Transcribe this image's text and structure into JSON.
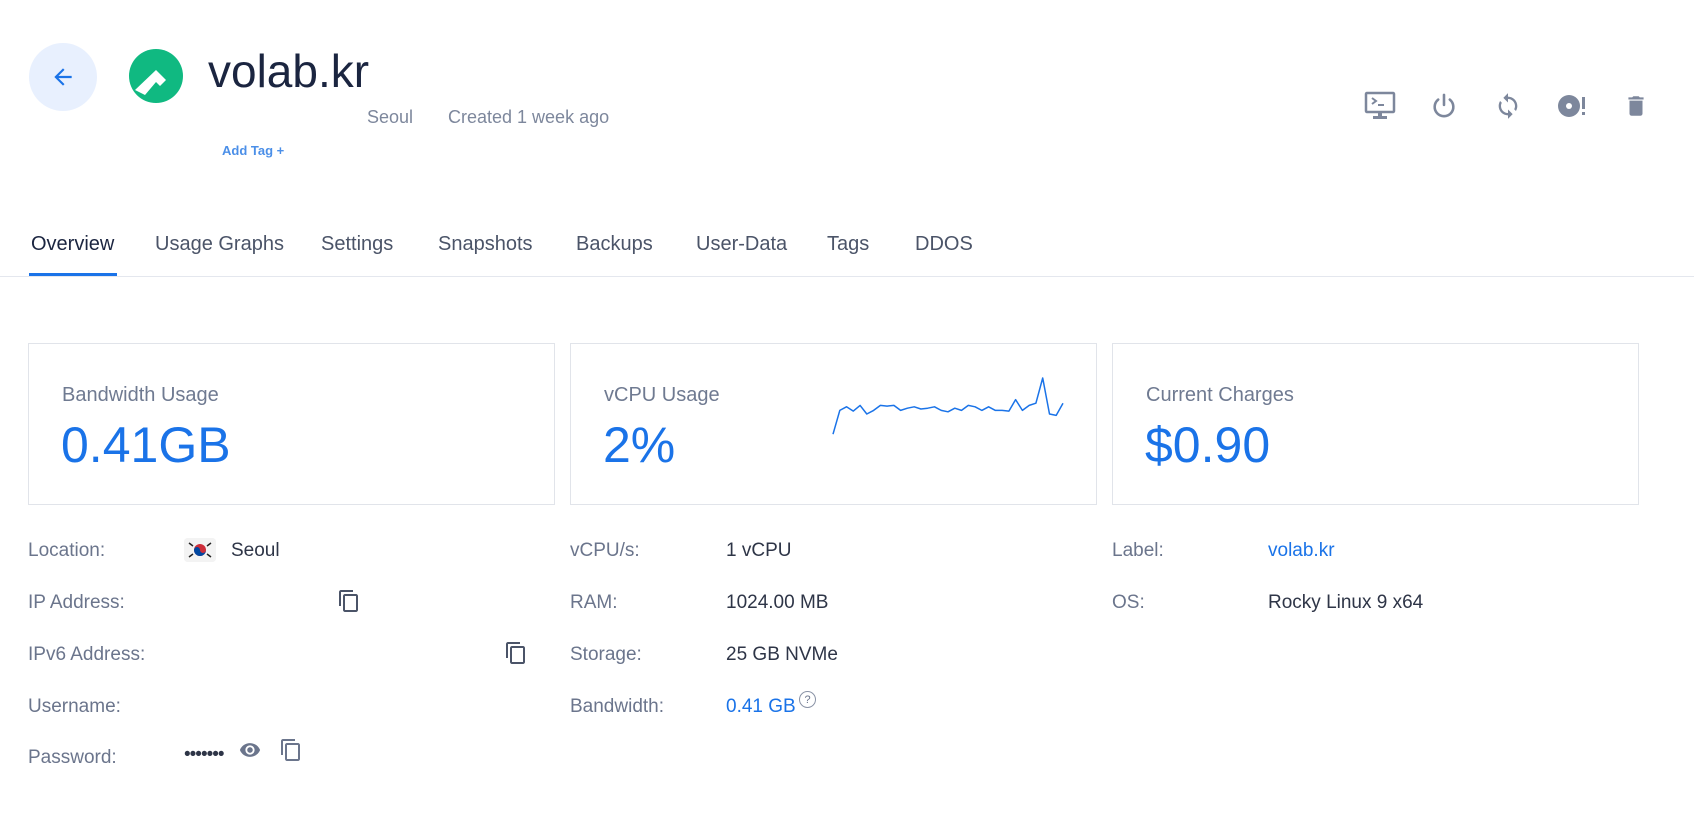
{
  "header": {
    "title": "volab.kr",
    "location": "Seoul",
    "created": "Created 1 week ago",
    "add_tag": "Add Tag +",
    "back_icon": "arrow-left-icon",
    "os_logo": "rocky-linux-logo",
    "actions": [
      {
        "name": "console-icon"
      },
      {
        "name": "power-icon"
      },
      {
        "name": "restart-icon"
      },
      {
        "name": "reinstall-disc-icon"
      },
      {
        "name": "trash-icon"
      }
    ]
  },
  "tabs": [
    "Overview",
    "Usage Graphs",
    "Settings",
    "Snapshots",
    "Backups",
    "User-Data",
    "Tags",
    "DDOS"
  ],
  "active_tab": "Overview",
  "cards": {
    "bandwidth": {
      "label": "Bandwidth Usage",
      "value": "0.41GB"
    },
    "vcpu": {
      "label": "vCPU Usage",
      "value": "2%",
      "sparkline": [
        0.22,
        0.55,
        0.6,
        0.54,
        0.62,
        0.5,
        0.55,
        0.62,
        0.61,
        0.62,
        0.55,
        0.58,
        0.6,
        0.57,
        0.58,
        0.6,
        0.55,
        0.53,
        0.58,
        0.55,
        0.62,
        0.6,
        0.55,
        0.6,
        0.55,
        0.55,
        0.54,
        0.7,
        0.55,
        0.62,
        0.65,
        1.0,
        0.5,
        0.48,
        0.65
      ]
    },
    "charges": {
      "label": "Current Charges",
      "value": "$0.90"
    }
  },
  "details": {
    "col1": {
      "location_label": "Location:",
      "location_value": "Seoul",
      "ip_label": "IP Address:",
      "ipv6_label": "IPv6 Address:",
      "username_label": "Username:",
      "password_label": "Password:",
      "password_value": "•••••••"
    },
    "col2": {
      "vcpu_label": "vCPU/s:",
      "vcpu_value": "1 vCPU",
      "ram_label": "RAM:",
      "ram_value": "1024.00 MB",
      "storage_label": "Storage:",
      "storage_value": "25 GB NVMe",
      "bandwidth_label": "Bandwidth:",
      "bandwidth_value": "0.41 GB",
      "help": "?"
    },
    "col3": {
      "label_label": "Label:",
      "label_value": "volab.kr",
      "os_label": "OS:",
      "os_value": "Rocky Linux 9 x64"
    }
  },
  "colors": {
    "accent": "#1a73e8",
    "logo_green": "#10b981"
  }
}
